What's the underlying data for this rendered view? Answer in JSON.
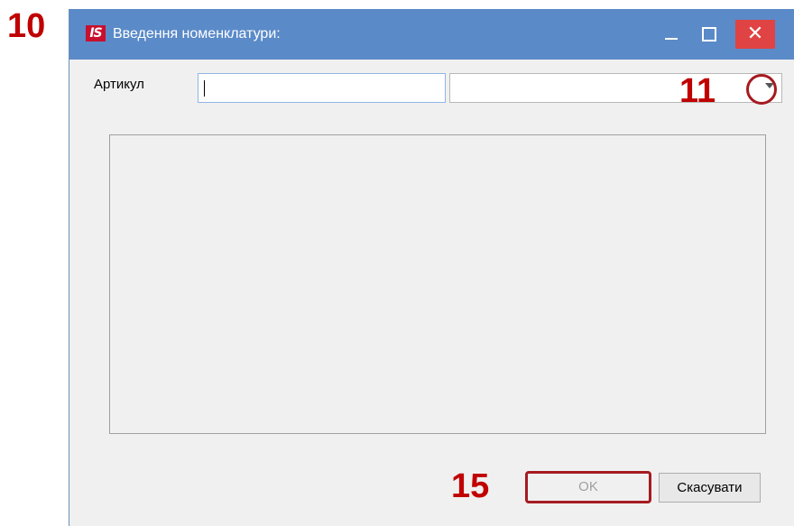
{
  "annotations": {
    "step10": "10",
    "step11": "11",
    "step15": "15"
  },
  "window": {
    "title": "Введення номенклатури:",
    "logo_text": "IS"
  },
  "titlebar": {
    "minimize_glyph": "_",
    "close_glyph": "✕"
  },
  "form": {
    "article_label": "Артикул",
    "article_value": "",
    "combo_value": ""
  },
  "buttons": {
    "ok": "OK",
    "cancel": "Скасувати"
  },
  "colors": {
    "titlebar": "#5b8ac8",
    "close": "#e04343",
    "annotation": "#c00000"
  },
  "icons": {
    "combo_arrow": "chevron-down-icon",
    "app": "app-logo-icon"
  }
}
